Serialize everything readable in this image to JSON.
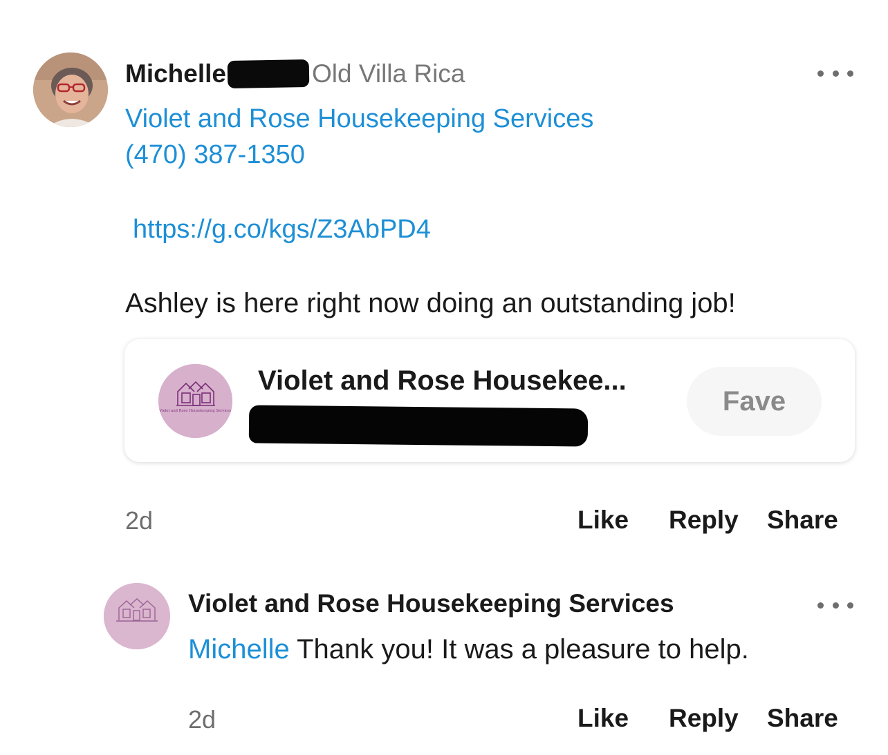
{
  "post": {
    "author_name": "Michelle",
    "neighborhood": "Old Villa Rica",
    "business_link": "Violet and Rose Housekeeping Services",
    "phone": "(470) 387-1350",
    "url": "https://g.co/kgs/Z3AbPD4",
    "text": "Ashley is here right now doing an outstanding job!",
    "time": "2d",
    "actions": {
      "like": "Like",
      "reply": "Reply",
      "share": "Share"
    }
  },
  "business_card": {
    "name": "Violet and Rose Housekee...",
    "logo_text": "Violet and Rose Housekeeping Services",
    "fave_label": "Fave"
  },
  "reply": {
    "author_name": "Violet and Rose Housekeeping Services",
    "mention": "Michelle",
    "text": " Thank you! It was a pleasure to help.",
    "time": "2d",
    "actions": {
      "like": "Like",
      "reply": "Reply",
      "share": "Share"
    }
  },
  "icons": {
    "more": "more-horizontal-icon",
    "logo": "houses-logo-icon"
  },
  "colors": {
    "link": "#1d8fd6",
    "text": "#1a1a1a",
    "muted": "#6e6e6e",
    "logo_bg": "#d7b0cc",
    "logo_ink": "#7a2f78"
  }
}
